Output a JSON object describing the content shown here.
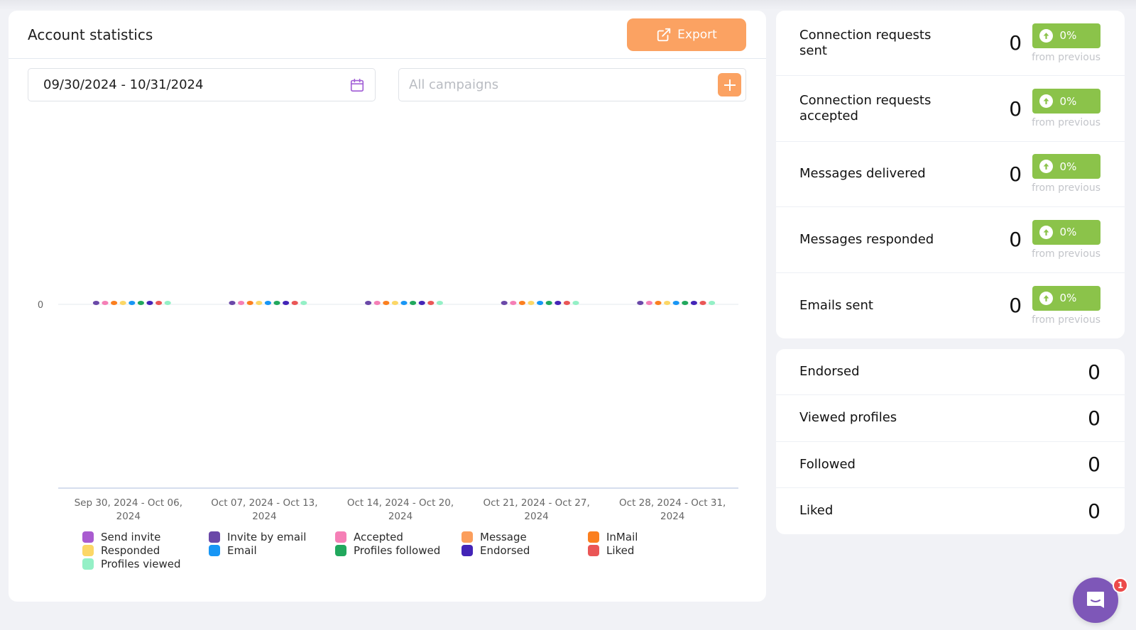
{
  "header": {
    "title": "Account statistics",
    "export_label": "Export"
  },
  "filters": {
    "date_range": "09/30/2024 - 10/31/2024",
    "campaigns_placeholder": "All campaigns"
  },
  "colors": {
    "accent": "#fba262",
    "badge_green": "#8bc34a",
    "chat": "#7e57b8"
  },
  "chart_data": {
    "type": "bar",
    "title": "",
    "xlabel": "",
    "ylabel": "",
    "ylim": [
      0,
      0
    ],
    "yticks": [
      "0"
    ],
    "categories": [
      [
        "Sep 30, 2024 - Oct 06,",
        "2024"
      ],
      [
        "Oct 07, 2024 - Oct 13,",
        "2024"
      ],
      [
        "Oct 14, 2024 - Oct 20,",
        "2024"
      ],
      [
        "Oct 21, 2024 - Oct 27,",
        "2024"
      ],
      [
        "Oct 28, 2024 - Oct 31,",
        "2024"
      ]
    ],
    "legend_position": "bottom",
    "series": [
      {
        "name": "Send invite",
        "color": "#a95bd0",
        "values": [
          0,
          0,
          0,
          0,
          0
        ],
        "shown_in_plot": false
      },
      {
        "name": "Invite by email",
        "color": "#6a48a8",
        "values": [
          0,
          0,
          0,
          0,
          0
        ],
        "shown_in_plot": true
      },
      {
        "name": "Accepted",
        "color": "#f57fb6",
        "values": [
          0,
          0,
          0,
          0,
          0
        ],
        "shown_in_plot": true
      },
      {
        "name": "Message",
        "color": "#fb9e5c",
        "values": [
          0,
          0,
          0,
          0,
          0
        ],
        "shown_in_plot": false
      },
      {
        "name": "InMail",
        "color": "#fb7f1f",
        "values": [
          0,
          0,
          0,
          0,
          0
        ],
        "shown_in_plot": true
      },
      {
        "name": "Responded",
        "color": "#fcd766",
        "values": [
          0,
          0,
          0,
          0,
          0
        ],
        "shown_in_plot": true
      },
      {
        "name": "Email",
        "color": "#1796f5",
        "values": [
          0,
          0,
          0,
          0,
          0
        ],
        "shown_in_plot": true
      },
      {
        "name": "Profiles followed",
        "color": "#21a85d",
        "values": [
          0,
          0,
          0,
          0,
          0
        ],
        "shown_in_plot": true
      },
      {
        "name": "Endorsed",
        "color": "#4324b7",
        "values": [
          0,
          0,
          0,
          0,
          0
        ],
        "shown_in_plot": true
      },
      {
        "name": "Liked",
        "color": "#ea5656",
        "values": [
          0,
          0,
          0,
          0,
          0
        ],
        "shown_in_plot": true
      },
      {
        "name": "Profiles viewed",
        "color": "#94f0c6",
        "values": [
          0,
          0,
          0,
          0,
          0
        ],
        "shown_in_plot": true
      }
    ],
    "legend_columns": [
      [
        "Send invite",
        "Responded",
        "Profiles viewed"
      ],
      [
        "Invite by email",
        "Email"
      ],
      [
        "Accepted",
        "Profiles followed"
      ],
      [
        "Message",
        "Endorsed"
      ],
      [
        "InMail",
        "Liked"
      ]
    ]
  },
  "stats_primary": [
    {
      "label": "Connection requests sent",
      "value": "0",
      "change": "0%",
      "note": "from previous"
    },
    {
      "label": "Connection requests accepted",
      "value": "0",
      "change": "0%",
      "note": "from previous"
    },
    {
      "label": "Messages delivered",
      "value": "0",
      "change": "0%",
      "note": "from previous"
    },
    {
      "label": "Messages responded",
      "value": "0",
      "change": "0%",
      "note": "from previous"
    },
    {
      "label": "Emails sent",
      "value": "0",
      "change": "0%",
      "note": "from previous"
    }
  ],
  "stats_secondary": [
    {
      "label": "Endorsed",
      "value": "0"
    },
    {
      "label": "Viewed profiles",
      "value": "0"
    },
    {
      "label": "Followed",
      "value": "0"
    },
    {
      "label": "Liked",
      "value": "0"
    }
  ],
  "chat": {
    "unread_count": "1"
  }
}
